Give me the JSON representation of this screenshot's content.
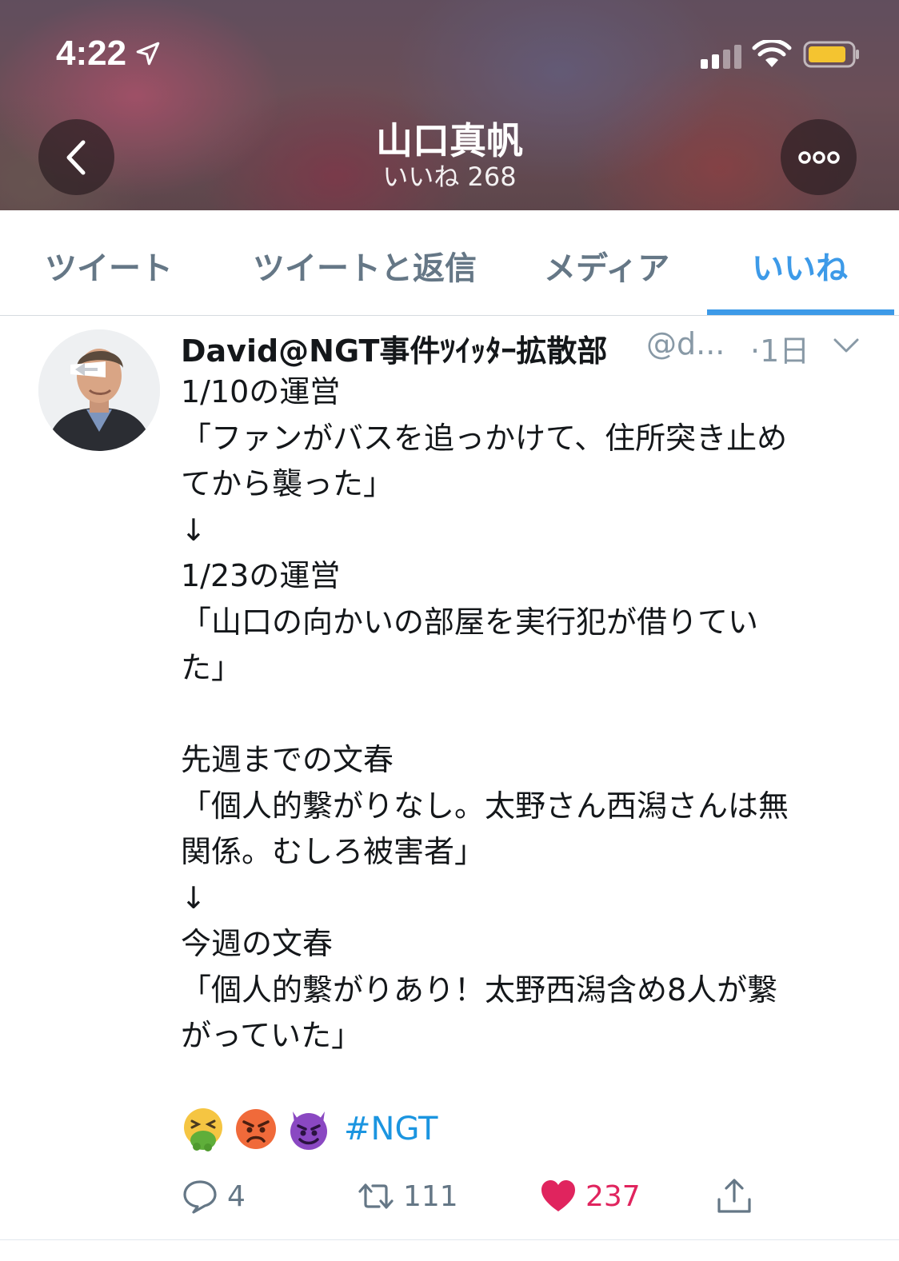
{
  "status_bar": {
    "time": "4:22"
  },
  "header": {
    "title": "山口真帆",
    "subtitle": "いいね 268"
  },
  "tabs": [
    {
      "label": "ツイート",
      "active": false
    },
    {
      "label": "ツイートと返信",
      "active": false
    },
    {
      "label": "メディア",
      "active": false
    },
    {
      "label": "いいね",
      "active": true
    }
  ],
  "tweet": {
    "author_name": "David@NGT事件ﾂｲｯﾀｰ拡散部",
    "handle": "@d...",
    "time": "·1日",
    "lines": [
      "1/10の運営",
      "「ファンがバスを追っかけて、住所突き止め",
      "てから襲った」",
      "↓",
      "1/23の運営",
      "「山口の向かいの部屋を実行犯が借りてい",
      "た」",
      "",
      "先週までの文春",
      "「個人的繋がりなし。太野さん西潟さんは無",
      "関係。むしろ被害者」",
      "↓",
      "今週の文春",
      "「個人的繋がりあり！太野西潟含め8人が繋",
      "がっていた」"
    ],
    "emojis": [
      "nauseated-face",
      "angry-face",
      "smiling-imp"
    ],
    "hashtag": "#NGT",
    "replies": "4",
    "retweets": "111",
    "likes": "237"
  },
  "colors": {
    "accent": "#3d9ae8",
    "like": "#e0245e",
    "muted": "#657786"
  }
}
